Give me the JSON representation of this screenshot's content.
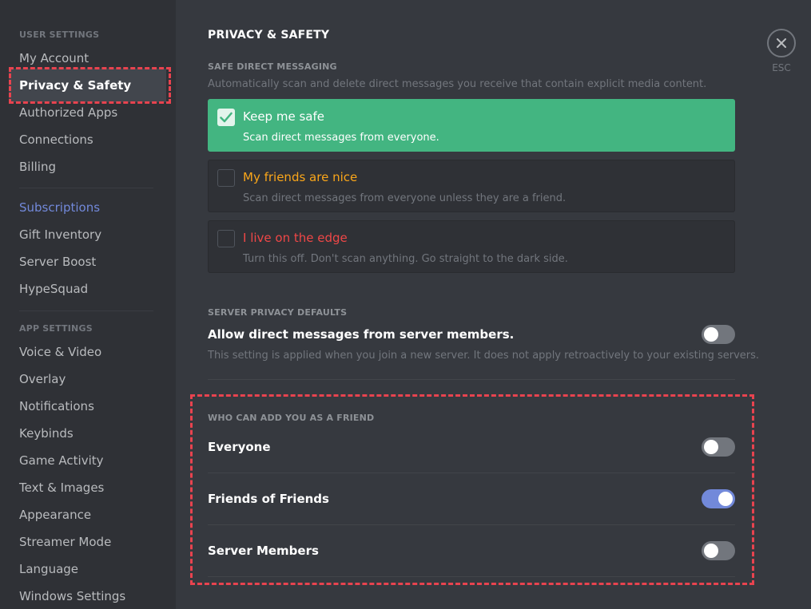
{
  "sidebar": {
    "user_settings_label": "USER SETTINGS",
    "app_settings_label": "APP SETTINGS",
    "items_user": [
      {
        "label": "My Account"
      },
      {
        "label": "Privacy & Safety"
      },
      {
        "label": "Authorized Apps"
      },
      {
        "label": "Connections"
      },
      {
        "label": "Billing"
      }
    ],
    "items_billing": [
      {
        "label": "Subscriptions"
      },
      {
        "label": "Gift Inventory"
      },
      {
        "label": "Server Boost"
      },
      {
        "label": "HypeSquad"
      }
    ],
    "items_app": [
      {
        "label": "Voice & Video"
      },
      {
        "label": "Overlay"
      },
      {
        "label": "Notifications"
      },
      {
        "label": "Keybinds"
      },
      {
        "label": "Game Activity"
      },
      {
        "label": "Text & Images"
      },
      {
        "label": "Appearance"
      },
      {
        "label": "Streamer Mode"
      },
      {
        "label": "Language"
      },
      {
        "label": "Windows Settings"
      }
    ],
    "selected": "Privacy & Safety"
  },
  "main": {
    "title": "PRIVACY & SAFETY",
    "close_label": "ESC",
    "safe_dm": {
      "label": "SAFE DIRECT MESSAGING",
      "description": "Automatically scan and delete direct messages you receive that contain explicit media content.",
      "options": [
        {
          "title": "Keep me safe",
          "subtitle": "Scan direct messages from everyone.",
          "selected": true,
          "title_color": "#ffffff"
        },
        {
          "title": "My friends are nice",
          "subtitle": "Scan direct messages from everyone unless they are a friend.",
          "selected": false,
          "title_color": "#faa61a"
        },
        {
          "title": "I live on the edge",
          "subtitle": "Turn this off. Don't scan anything. Go straight to the dark side.",
          "selected": false,
          "title_color": "#f04747"
        }
      ]
    },
    "server_privacy": {
      "label": "SERVER PRIVACY DEFAULTS",
      "setting": "Allow direct messages from server members.",
      "description": "This setting is applied when you join a new server. It does not apply retroactively to your existing servers.",
      "enabled": false
    },
    "friend_requests": {
      "label": "WHO CAN ADD YOU AS A FRIEND",
      "items": [
        {
          "label": "Everyone",
          "enabled": false
        },
        {
          "label": "Friends of Friends",
          "enabled": true
        },
        {
          "label": "Server Members",
          "enabled": false
        }
      ]
    }
  },
  "colors": {
    "accent": "#7289da",
    "safe_green": "#43b581",
    "highlight_dash": "#e8434f"
  }
}
